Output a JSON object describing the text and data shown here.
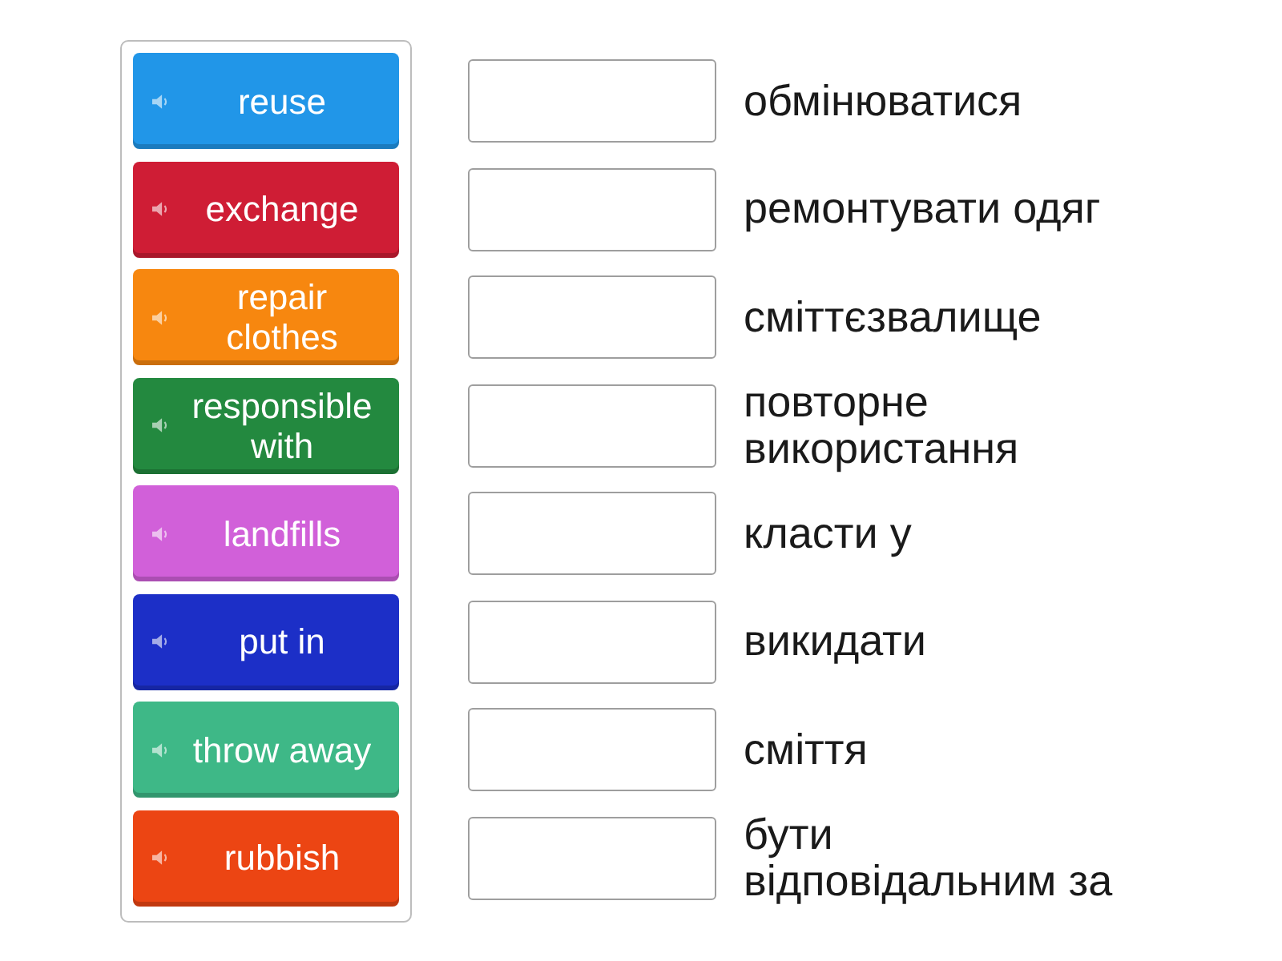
{
  "tiles": [
    {
      "label": "reuse",
      "color": "#2196e8"
    },
    {
      "label": "exchange",
      "color": "#cf1d35"
    },
    {
      "label": "repair clothes",
      "color": "#f7870f"
    },
    {
      "label": "responsible with",
      "color": "#23893f"
    },
    {
      "label": "landfills",
      "color": "#d160d9"
    },
    {
      "label": "put in",
      "color": "#1c2fc7"
    },
    {
      "label": "throw away",
      "color": "#3eb887"
    },
    {
      "label": "rubbish",
      "color": "#ec4513"
    }
  ],
  "definitions": [
    "обмінюватися",
    "ремонтувати одяг",
    "сміттєзвалище",
    "повторне використання",
    "класти у",
    "викидати",
    "сміття",
    "бути відповідальним за"
  ]
}
